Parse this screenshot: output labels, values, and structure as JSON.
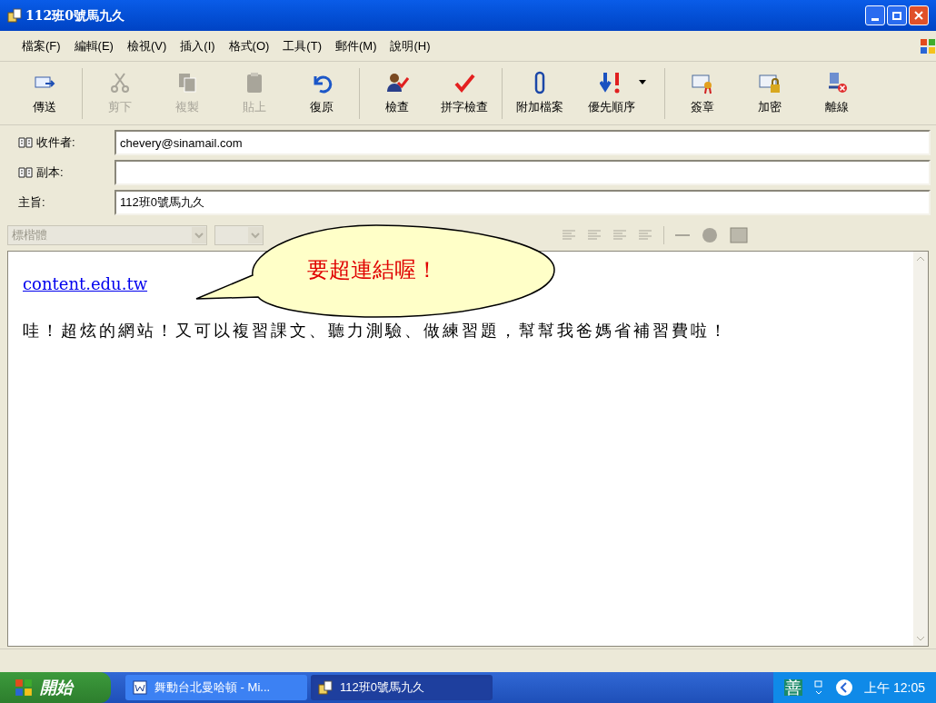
{
  "window": {
    "title": "112班0號馬九久"
  },
  "menu": [
    "檔案(F)",
    "編輯(E)",
    "檢視(V)",
    "插入(I)",
    "格式(O)",
    "工具(T)",
    "郵件(M)",
    "說明(H)"
  ],
  "toolbar": [
    [
      {
        "label": "傳送",
        "kind": "send",
        "disabled": false
      }
    ],
    [
      {
        "label": "剪下",
        "kind": "cut",
        "disabled": true
      },
      {
        "label": "複製",
        "kind": "copy",
        "disabled": true
      },
      {
        "label": "貼上",
        "kind": "paste",
        "disabled": true
      },
      {
        "label": "復原",
        "kind": "undo",
        "disabled": false
      }
    ],
    [
      {
        "label": "檢查",
        "kind": "check_person",
        "disabled": false
      },
      {
        "label": "拼字檢查",
        "kind": "check",
        "disabled": false
      }
    ],
    [
      {
        "label": "附加檔案",
        "kind": "clip",
        "disabled": false
      },
      {
        "label": "優先順序",
        "kind": "priority",
        "disabled": false,
        "dropdown": true
      }
    ],
    [
      {
        "label": "簽章",
        "kind": "sign",
        "disabled": false
      },
      {
        "label": "加密",
        "kind": "lock",
        "disabled": false
      },
      {
        "label": "離線",
        "kind": "offline",
        "disabled": false
      }
    ]
  ],
  "header_fields": [
    {
      "label": "收件者:",
      "address_book": true,
      "value": "chevery@sinamail.com"
    },
    {
      "label": "副本:",
      "address_book": true
    },
    {
      "label": "主旨:",
      "address_book": false,
      "value": "112班0號馬九久"
    }
  ],
  "format_bar": {
    "font": "標楷體",
    "disabled": true
  },
  "body": {
    "link": "content.edu.tw",
    "text": "哇！超炫的網站！又可以複習課文、聽力測驗、做練習題，幫幫我爸媽省補習費啦！"
  },
  "callout": {
    "text": "要超連結喔！"
  },
  "taskbar": {
    "start": "開始",
    "tasks": [
      {
        "label": "舞動台北曼哈頓 - Mi...",
        "kind": "word",
        "selected": false
      },
      {
        "label": "112班0號馬九久",
        "kind": "mail",
        "selected": true
      }
    ],
    "ime": "善",
    "time": "上午 12:05"
  }
}
